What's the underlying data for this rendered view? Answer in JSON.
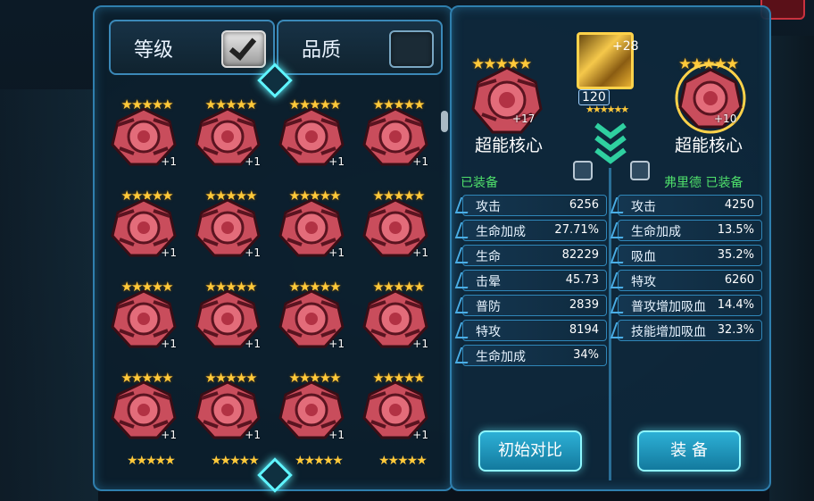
{
  "filters": [
    {
      "label": "等级",
      "checked": true
    },
    {
      "label": "品质",
      "checked": false
    }
  ],
  "inventory": {
    "item_stars": "★★★★★",
    "items": [
      {
        "plus": "+1"
      },
      {
        "plus": "+1"
      },
      {
        "plus": "+1"
      },
      {
        "plus": "+1"
      },
      {
        "plus": "+1"
      },
      {
        "plus": "+1"
      },
      {
        "plus": "+1"
      },
      {
        "plus": "+1"
      },
      {
        "plus": "+1"
      },
      {
        "plus": "+1"
      },
      {
        "plus": "+1"
      },
      {
        "plus": "+1"
      },
      {
        "plus": "+1"
      },
      {
        "plus": "+1"
      },
      {
        "plus": "+1"
      },
      {
        "plus": "+1"
      }
    ]
  },
  "hero": {
    "level": "120",
    "plus": "+28",
    "stars": "★★★★★★"
  },
  "left_item": {
    "name": "超能核心",
    "plus": "+17",
    "stars": "★★★★★",
    "status": "已装备",
    "stats": [
      {
        "name": "攻击",
        "value": "6256"
      },
      {
        "name": "生命加成",
        "value": "27.71%"
      },
      {
        "name": "生命",
        "value": "82229"
      },
      {
        "name": "击晕",
        "value": "45.73"
      },
      {
        "name": "普防",
        "value": "2839"
      },
      {
        "name": "特攻",
        "value": "8194"
      },
      {
        "name": "生命加成",
        "value": "34%"
      }
    ]
  },
  "right_item": {
    "name": "超能核心",
    "plus": "+10",
    "stars": "★★★★★",
    "status": "弗里德 已装备",
    "stats": [
      {
        "name": "攻击",
        "value": "4250"
      },
      {
        "name": "生命加成",
        "value": "13.5%"
      },
      {
        "name": "吸血",
        "value": "35.2%"
      },
      {
        "name": "特攻",
        "value": "6260"
      },
      {
        "name": "普攻增加吸血",
        "value": "14.4%"
      },
      {
        "name": "技能增加吸血",
        "value": "32.3%"
      }
    ]
  },
  "buttons": {
    "compare": "初始对比",
    "equip": "装 备"
  },
  "colors": {
    "accent": "#5ff5ff",
    "star": "#ffc93a",
    "equipped": "#4fe06b",
    "panel_border": "#2f7fae"
  }
}
